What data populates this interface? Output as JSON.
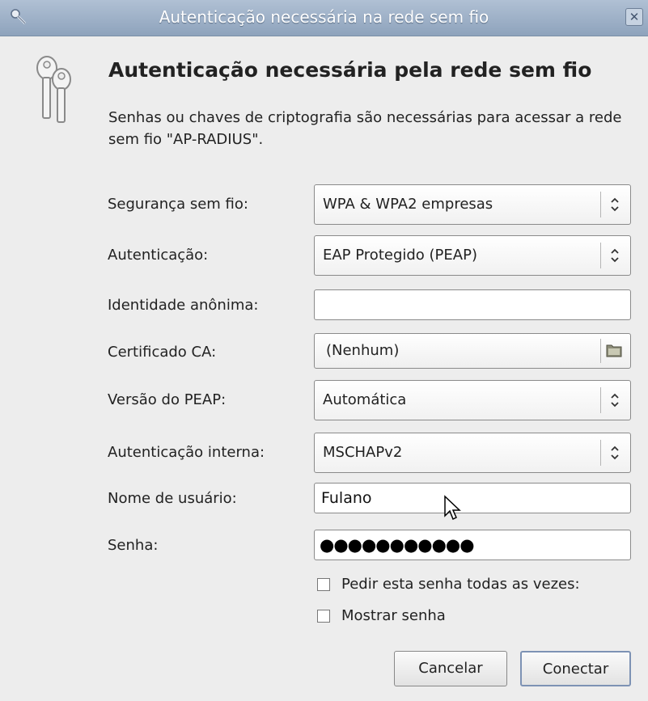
{
  "window": {
    "title": "Autenticação necessária na rede sem fio",
    "close_glyph": "✕",
    "title_icon": "key-icon"
  },
  "header": {
    "icon": "keys-icon",
    "heading": "Autenticação necessária pela rede sem fio",
    "description": "Senhas ou chaves de criptografia são necessárias para acessar a rede sem fio \"AP-RADIUS\"."
  },
  "form": {
    "security_label": "Segurança sem fio:",
    "security_value": "WPA & WPA2 empresas",
    "authentication_label": "Autenticação:",
    "authentication_value": "EAP Protegido (PEAP)",
    "anonymous_identity_label": "Identidade anônima:",
    "anonymous_identity_value": "",
    "ca_certificate_label": "Certificado CA:",
    "ca_certificate_value": "(Nenhum)",
    "peap_version_label": "Versão do PEAP:",
    "peap_version_value": "Automática",
    "inner_auth_label": "Autenticação interna:",
    "inner_auth_value": "MSCHAPv2",
    "username_label": "Nome de usuário:",
    "username_value": "Fulano",
    "password_label": "Senha:",
    "password_mask": "●●●●●●●●●●●",
    "ask_always_label": "Pedir esta senha todas as vezes:",
    "ask_always_checked": false,
    "show_password_label": "Mostrar senha",
    "show_password_checked": false
  },
  "buttons": {
    "cancel": "Cancelar",
    "connect": "Conectar"
  },
  "colors": {
    "titlebar": "#8ea3bc",
    "window_bg": "#ededed",
    "default_button_border": "#7d92b4"
  }
}
